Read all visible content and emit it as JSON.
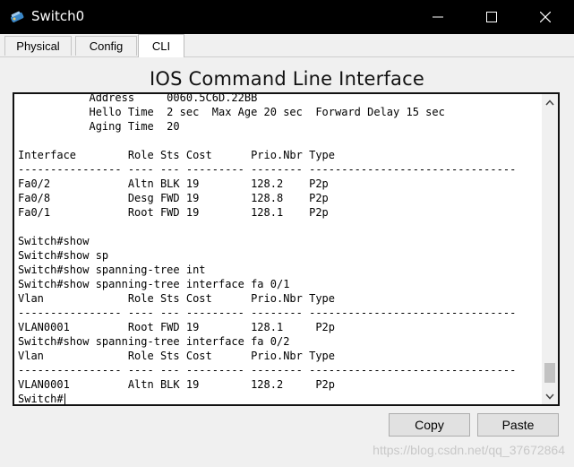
{
  "window": {
    "title": "Switch0"
  },
  "tabs": [
    {
      "label": "Physical"
    },
    {
      "label": "Config"
    },
    {
      "label": "CLI"
    }
  ],
  "heading": "IOS Command Line Interface",
  "terminal": {
    "lines": [
      "           Address     0060.5C6D.22BB",
      "           Hello Time  2 sec  Max Age 20 sec  Forward Delay 15 sec",
      "           Aging Time  20",
      "",
      "Interface        Role Sts Cost      Prio.Nbr Type",
      "---------------- ---- --- --------- -------- --------------------------------",
      "Fa0/2            Altn BLK 19        128.2    P2p",
      "Fa0/8            Desg FWD 19        128.8    P2p",
      "Fa0/1            Root FWD 19        128.1    P2p",
      "",
      "Switch#show",
      "Switch#show sp",
      "Switch#show spanning-tree int",
      "Switch#show spanning-tree interface fa 0/1",
      "Vlan             Role Sts Cost      Prio.Nbr Type",
      "---------------- ---- --- --------- -------- --------------------------------",
      "VLAN0001         Root FWD 19        128.1     P2p",
      "Switch#show spanning-tree interface fa 0/2",
      "Vlan             Role Sts Cost      Prio.Nbr Type",
      "---------------- ---- --- --------- -------- --------------------------------",
      "VLAN0001         Altn BLK 19        128.2     P2p",
      "Switch#"
    ]
  },
  "buttons": {
    "copy": "Copy",
    "paste": "Paste"
  },
  "watermark": "https://blog.csdn.net/qq_37672864",
  "icons": {
    "app": "switch-device-icon",
    "minimize": "minimize-icon",
    "maximize": "maximize-icon",
    "close": "close-icon",
    "scroll_up": "chevron-up-icon",
    "scroll_down": "chevron-down-icon"
  },
  "colors": {
    "titlebar": "#000000",
    "terminal_bg": "#ffffff",
    "window_bg": "#f0f0f0"
  }
}
